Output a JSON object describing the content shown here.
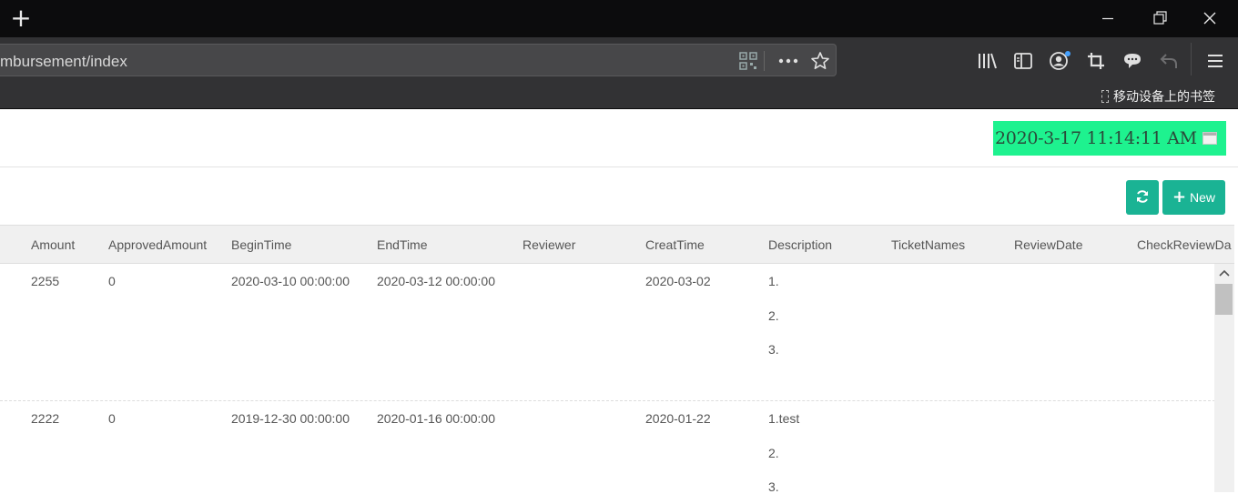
{
  "browser": {
    "url": "mbursement/index",
    "bookmark_mobile": "移动设备上的书签"
  },
  "page": {
    "datetime": "2020-3-17 11:14:11 AM",
    "new_button": "New"
  },
  "table": {
    "headers": [
      "Amount",
      "ApprovedAmount",
      "BeginTime",
      "EndTime",
      "Reviewer",
      "CreatTime",
      "Description",
      "TicketNames",
      "ReviewDate",
      "CheckReviewDa"
    ],
    "rows": [
      {
        "amount": "2255",
        "approved": "0",
        "begin": "2020-03-10 00:00:00",
        "end": "2020-03-12 00:00:00",
        "created": "2020-03-02",
        "desc": [
          "1.",
          "2.",
          "3."
        ]
      },
      {
        "amount": "2222",
        "approved": "0",
        "begin": "2019-12-30 00:00:00",
        "end": "2020-01-16 00:00:00",
        "created": "2020-01-22",
        "desc": [
          "1.test",
          "2.",
          "3."
        ]
      }
    ]
  },
  "colors": {
    "accent": "#1ab394",
    "datetime_bg": "#1ef28f",
    "browser_dark": "#323234"
  }
}
